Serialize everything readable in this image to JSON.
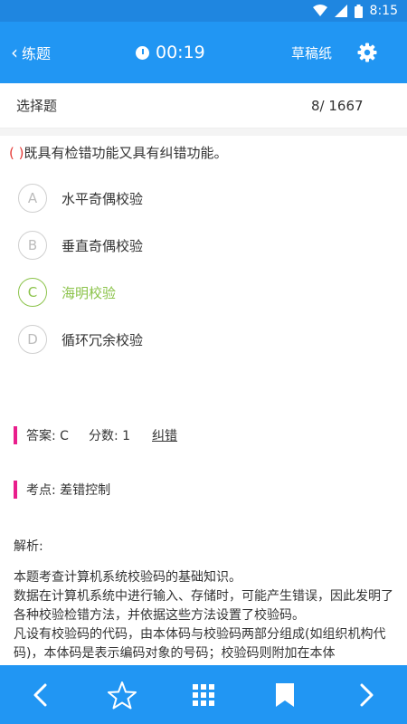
{
  "status_bar": {
    "time": "8:15"
  },
  "app_bar": {
    "back_label": "练题",
    "timer": "00:19",
    "draft_label": "草稿纸"
  },
  "subheader": {
    "type_label": "选择题",
    "progress": "8/ 1667"
  },
  "question": {
    "paren": "( )",
    "text": "既具有检错功能又具有纠错功能。"
  },
  "options": [
    {
      "letter": "A",
      "text": "水平奇偶校验",
      "selected": false
    },
    {
      "letter": "B",
      "text": "垂直奇偶校验",
      "selected": false
    },
    {
      "letter": "C",
      "text": "海明校验",
      "selected": true
    },
    {
      "letter": "D",
      "text": "循环冗余校验",
      "selected": false
    }
  ],
  "answer_info": {
    "answer": "答案: C",
    "score": "分数: 1",
    "report_error": "纠错"
  },
  "knowledge_point": "考点: 差错控制",
  "analysis": {
    "title": "解析:",
    "lines": [
      "本题考查计算机系统校验码的基础知识。",
      "数据在计算机系统中进行输入、存储时，可能产生错误，因此发明了各种校验检错方法，并依据这些方法设置了校验码。",
      "凡设有校验码的代码，由本体码与校验码两部分组成(如组织机构代码)，本体码是表示编码对象的号码；校验码则附加在本体"
    ]
  },
  "colors": {
    "primary": "#2196f3",
    "selected": "#8bc34a",
    "accent_bar": "#e91e8c",
    "paren": "#e53935"
  },
  "bottom_bar": [
    "chevron-left-icon",
    "star-icon",
    "grid-icon",
    "bookmark-icon",
    "chevron-right-icon"
  ]
}
